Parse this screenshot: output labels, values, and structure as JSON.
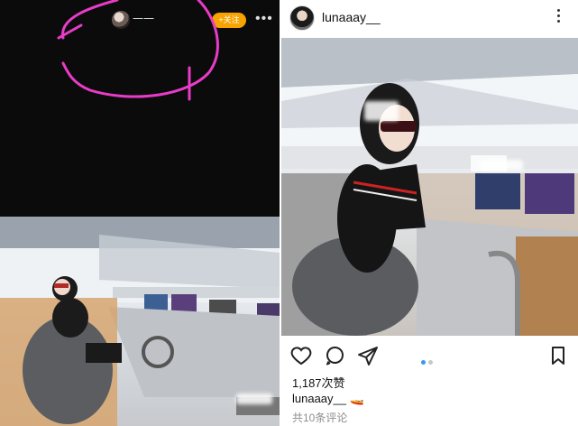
{
  "left_panel": {
    "user_name": "一一",
    "follow_label": "+关注",
    "more_label": "•••",
    "icons": [
      "avatar",
      "more-icon"
    ],
    "colors": {
      "follow": "#f7a400",
      "scribble": "#e83cc8"
    }
  },
  "right_panel": {
    "username": "lunaaay__",
    "likes": "1,187次赞",
    "caption_user": "lunaaay__",
    "caption_emoji": "🚤",
    "comments": "共10条评论",
    "icons": [
      "heart-icon",
      "comment-icon",
      "share-icon",
      "bookmark-icon"
    ],
    "carousel": {
      "count": 2,
      "active": 0
    },
    "colors": {
      "accent": "#3897f0"
    }
  }
}
